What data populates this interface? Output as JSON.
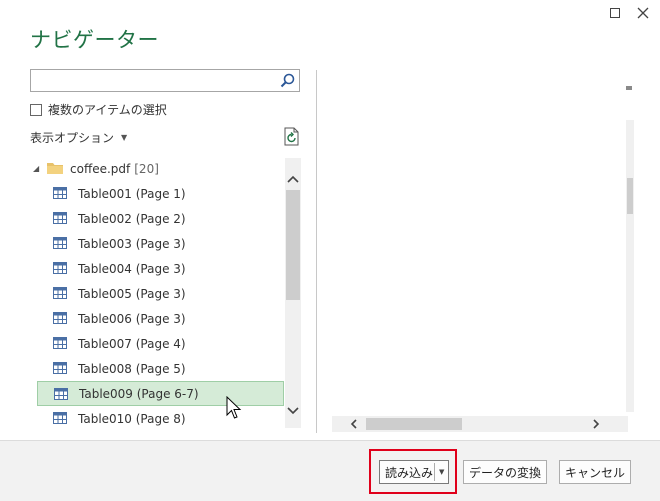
{
  "window": {
    "title": "ナビゲーター",
    "maximize_icon": "maximize-icon",
    "close_icon": "close-icon"
  },
  "search": {
    "value": "",
    "placeholder": "",
    "icon": "search-icon"
  },
  "select_multiple": {
    "label": "複数のアイテムの選択",
    "checked": false
  },
  "display_options": {
    "label": "表示オプション",
    "icon": "chevron-down-icon"
  },
  "refresh_icon": "refresh-document-icon",
  "tree": {
    "folder": {
      "name": "coffee.pdf",
      "count": "[20]",
      "expanded": true
    },
    "items": [
      {
        "label": "Table001 (Page 1)",
        "selected": false
      },
      {
        "label": "Table002 (Page 2)",
        "selected": false
      },
      {
        "label": "Table003 (Page 3)",
        "selected": false
      },
      {
        "label": "Table004 (Page 3)",
        "selected": false
      },
      {
        "label": "Table005 (Page 3)",
        "selected": false
      },
      {
        "label": "Table006 (Page 3)",
        "selected": false
      },
      {
        "label": "Table007 (Page 4)",
        "selected": false
      },
      {
        "label": "Table008 (Page 5)",
        "selected": false
      },
      {
        "label": "Table009 (Page 6-7)",
        "selected": true
      },
      {
        "label": "Table010 (Page 8)",
        "selected": false
      }
    ]
  },
  "footer": {
    "load_label": "読み込み",
    "transform_label": "データの変換",
    "cancel_label": "キャンセル"
  },
  "colors": {
    "title": "#217346",
    "selected_row": "#d5ebd7",
    "highlight_border": "#e0001b"
  }
}
